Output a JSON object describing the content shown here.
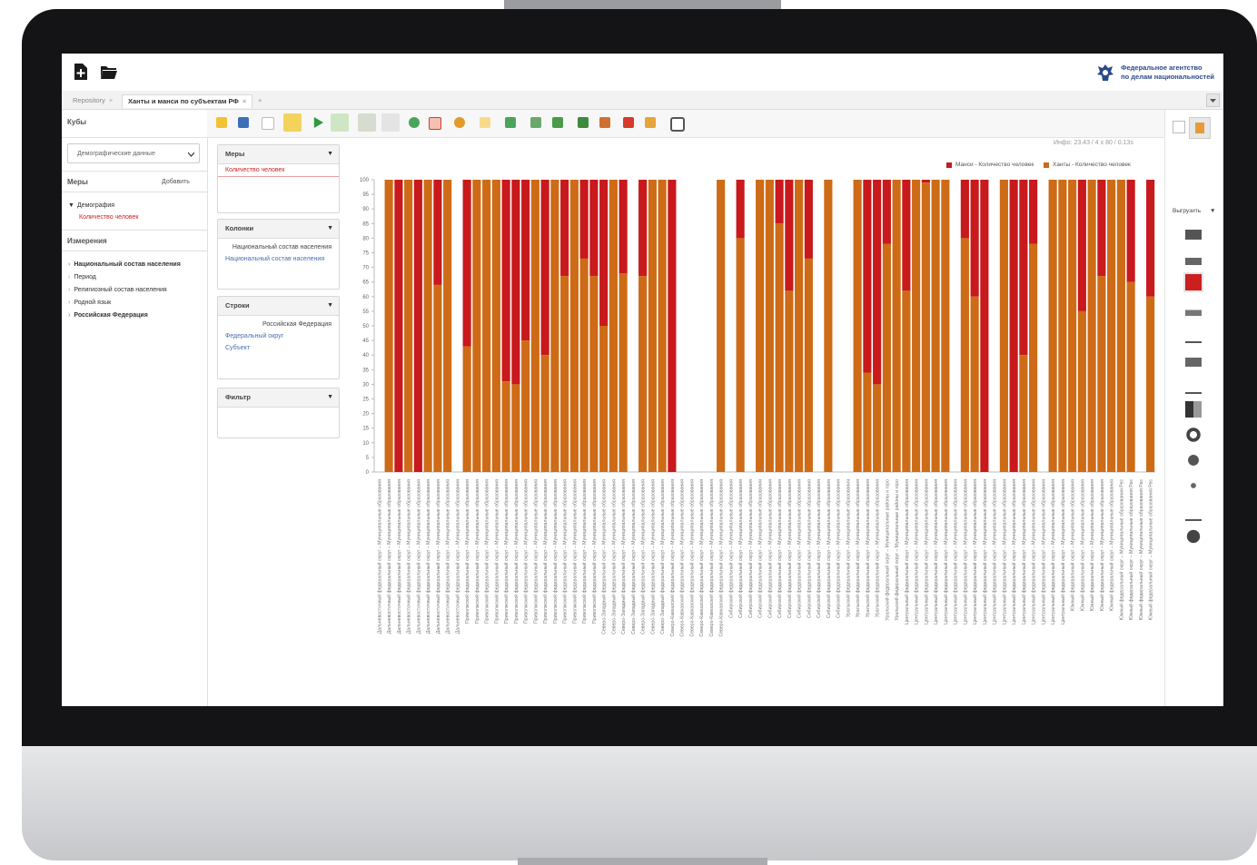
{
  "window": {
    "org_line1": "Федеральное агентство",
    "org_line2": "по делам национальностей"
  },
  "tabs": [
    {
      "label": "Repository",
      "close": "×"
    },
    {
      "label": "Ханты и манси по субъектам РФ",
      "close": "×"
    },
    {
      "label": "+"
    }
  ],
  "left": {
    "cubes_title": "Кубы",
    "cube_select": "Демографические данные",
    "measures_title": "Меры",
    "add_label": "Добавить",
    "tree_root": "Демография",
    "tree_measure": "Количество человек",
    "dimensions_title": "Измерения",
    "dimensions": [
      "Национальный состав населения",
      "Период",
      "Религиозный состав населения",
      "Родной язык",
      "Российская Федерация"
    ]
  },
  "pivot": {
    "measures": {
      "title": "Меры",
      "items": [
        "Количество человек"
      ]
    },
    "columns": {
      "title": "Колонки",
      "items": [
        "Национальный состав населения",
        "Национальный состав населения"
      ]
    },
    "rows": {
      "title": "Строки",
      "items": [
        "Российская Федерация",
        "Федеральный округ",
        "Субъект"
      ]
    },
    "filter": {
      "title": "Фильтр"
    }
  },
  "info_text": "Инфо: 23.43  /  4 x 80  /  0.13s",
  "right": {
    "export_label": "Выгрузить",
    "chart_types": [
      "bar-chart-icon",
      "grouped-bar-icon",
      "stacked-bar-100-icon",
      "small-multiples-icon",
      "line-chart-icon",
      "area-chart-icon",
      "dot-plot-icon",
      "heatmap-icon",
      "donut-icon",
      "multi-pie-icon",
      "scatter-icon",
      "waterfall-icon",
      "bubble-icon"
    ]
  },
  "chart_data": {
    "type": "bar",
    "stacked": true,
    "normalized_percent": true,
    "ylim": [
      0,
      100
    ],
    "yticks": [
      0,
      5,
      10,
      15,
      20,
      25,
      30,
      35,
      40,
      45,
      50,
      55,
      60,
      65,
      70,
      75,
      80,
      85,
      90,
      95,
      100
    ],
    "legend_position": "top-right",
    "series": [
      {
        "name": "Манси - Количество человек",
        "color": "#c8191c"
      },
      {
        "name": "Ханты - Количество человек",
        "color": "#cd6b16"
      }
    ],
    "khanty_percent": [
      null,
      100,
      0,
      100,
      0,
      100,
      64,
      100,
      null,
      43,
      100,
      100,
      100,
      31,
      30,
      45,
      100,
      40,
      100,
      67,
      100,
      73,
      67,
      50,
      100,
      68,
      null,
      67,
      100,
      100,
      0,
      null,
      null,
      null,
      null,
      100,
      null,
      80,
      null,
      100,
      100,
      85,
      62,
      100,
      73,
      null,
      100,
      null,
      null,
      100,
      34,
      30,
      78,
      100,
      62,
      100,
      99,
      100,
      100,
      null,
      80,
      60,
      0,
      null,
      100,
      0,
      40,
      78,
      null,
      100,
      100,
      100,
      55,
      100,
      67,
      100,
      100,
      65,
      null,
      60
    ],
    "x_category_counts": [
      {
        "label": "Дальневосточный федеральный округ – Муниципальные образования",
        "count": 9
      },
      {
        "label": "Приволжский федеральный округ – Муниципальные образования",
        "count": 14
      },
      {
        "label": "Северо-Западный федеральный округ – Муниципальные образования",
        "count": 7
      },
      {
        "label": "Северо-Кавказский федеральный округ – Муниципальные образования",
        "count": 6
      },
      {
        "label": "Сибирский федеральный округ – Муниципальные образования",
        "count": 12
      },
      {
        "label": "Уральский федеральный округ – Муниципальные образования",
        "count": 4
      },
      {
        "label": "Уральский федеральный округ – Муниципальные районы и горо",
        "count": 2
      },
      {
        "label": "Центральный федеральный округ – Муниципальные образования",
        "count": 17
      },
      {
        "label": "Южный федеральный округ – Муниципальные образования",
        "count": 5
      },
      {
        "label": "Южный федеральный округ – Муниципальные образования Рес",
        "count": 4
      }
    ]
  }
}
